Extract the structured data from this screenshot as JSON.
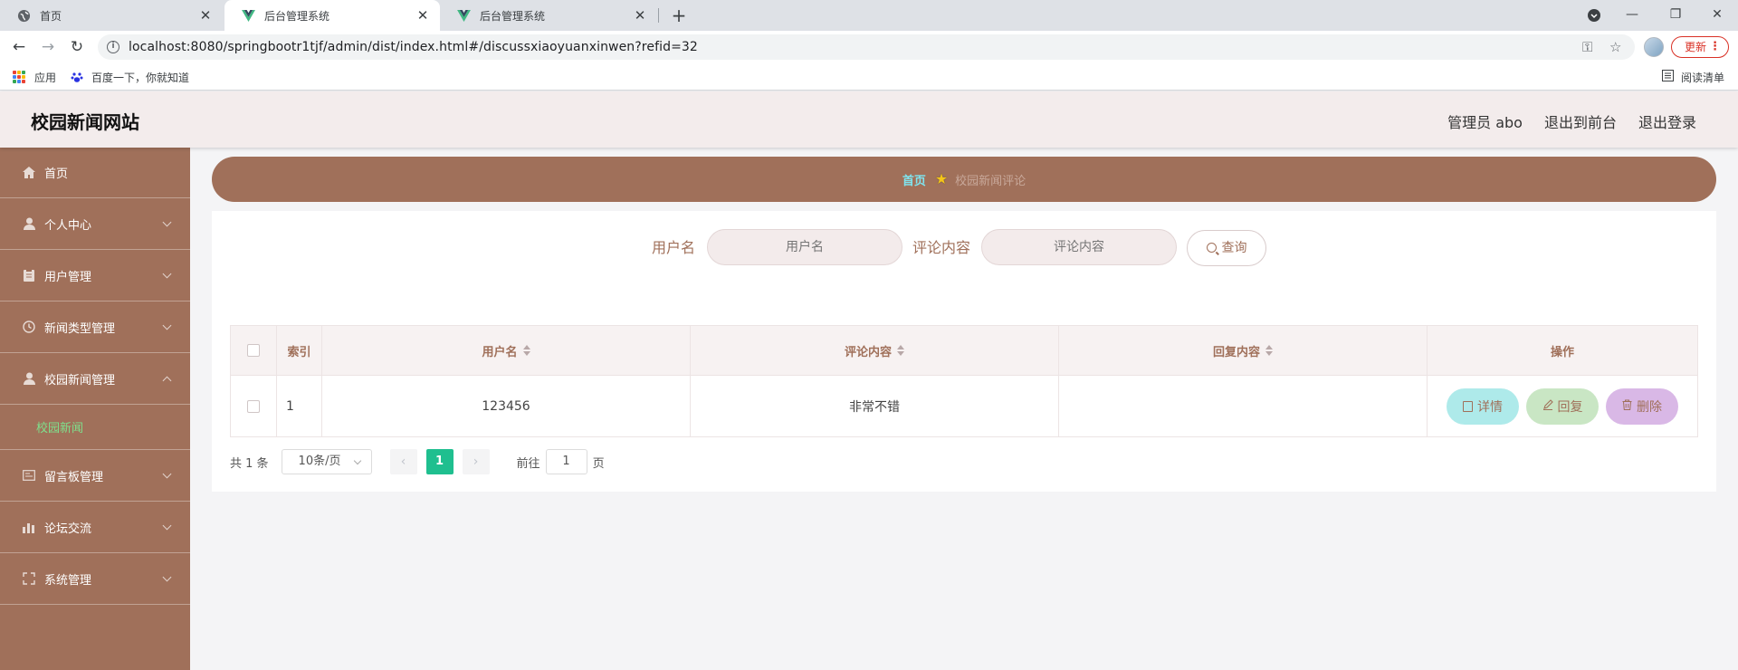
{
  "browser": {
    "tabs": [
      {
        "title": "首页",
        "active": false
      },
      {
        "title": "后台管理系统",
        "active": true
      },
      {
        "title": "后台管理系统",
        "active": false
      }
    ],
    "url": "localhost:8080/springbootr1tjf/admin/dist/index.html#/discussxiaoyuanxinwen?refid=32",
    "update_label": "更新",
    "bookmarks": [
      {
        "label": "应用",
        "icon": "apps-grid-icon"
      },
      {
        "label": "百度一下，你就知道",
        "icon": "baidu-paw-icon"
      }
    ],
    "reading_list": "阅读清单"
  },
  "header": {
    "title": "校园新闻网站",
    "user": "管理员 abo",
    "back_to_front": "退出到前台",
    "logout": "退出登录"
  },
  "sidebar": {
    "items": [
      {
        "label": "首页",
        "icon": "home-icon"
      },
      {
        "label": "个人中心",
        "icon": "user-icon"
      },
      {
        "label": "用户管理",
        "icon": "clipboard-icon"
      },
      {
        "label": "新闻类型管理",
        "icon": "clock-icon"
      },
      {
        "label": "校园新闻管理",
        "icon": "user-icon",
        "expanded": true
      },
      {
        "label": "留言板管理",
        "icon": "message-board-icon"
      },
      {
        "label": "论坛交流",
        "icon": "bar-chart-icon"
      },
      {
        "label": "系统管理",
        "icon": "fullscreen-icon"
      }
    ],
    "sub_item": "校园新闻"
  },
  "breadcrumb": {
    "home": "首页",
    "current": "校园新闻评论"
  },
  "search": {
    "username_label": "用户名",
    "username_placeholder": "用户名",
    "content_label": "评论内容",
    "content_placeholder": "评论内容",
    "query_button": "查询"
  },
  "table": {
    "headers": {
      "index": "索引",
      "username": "用户名",
      "content": "评论内容",
      "reply": "回复内容",
      "actions": "操作"
    },
    "rows": [
      {
        "index": "1",
        "username": "123456",
        "content": "非常不错",
        "reply": ""
      }
    ],
    "actions": {
      "detail": "详情",
      "reply": "回复",
      "delete": "删除"
    }
  },
  "pagination": {
    "total": "共 1 条",
    "page_size": "10条/页",
    "current_page": "1",
    "goto_prefix": "前往",
    "goto_value": "1",
    "goto_suffix": "页"
  },
  "colors": {
    "brand": "#a0705a",
    "header_bg": "#f3ecec",
    "accent_green": "#1fbf8f",
    "detail_btn": "#aeeaea",
    "reply_btn": "#c9e6c4",
    "delete_btn": "#d9b8e6"
  }
}
